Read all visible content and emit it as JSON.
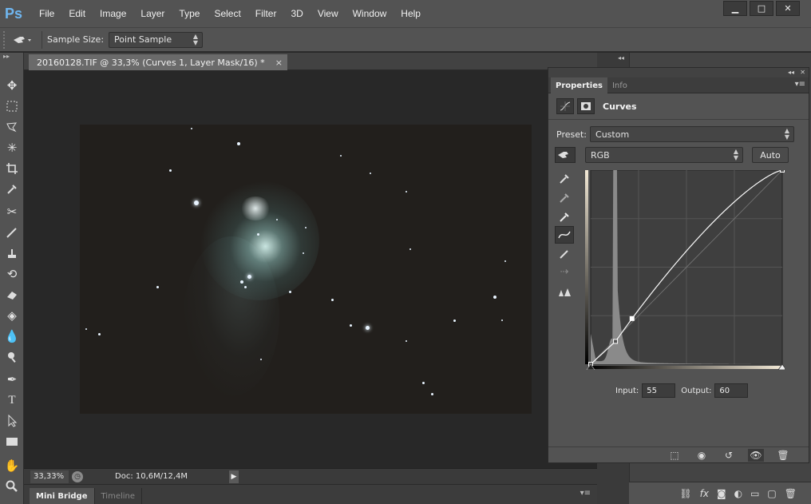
{
  "app": {
    "logo": "Ps"
  },
  "menu": [
    "File",
    "Edit",
    "Image",
    "Layer",
    "Type",
    "Select",
    "Filter",
    "3D",
    "View",
    "Window",
    "Help"
  ],
  "window_controls": {
    "minimize": "▁",
    "maximize": "□",
    "close": "✕"
  },
  "options_bar": {
    "tool_icon": "color-sampler-icon",
    "sample_size_label": "Sample Size:",
    "sample_size_value": "Point Sample"
  },
  "document": {
    "tab_title": "20160128.TIF @ 33,3% (Curves 1, Layer Mask/16) *",
    "close": "×"
  },
  "status": {
    "zoom": "33,33%",
    "doc_info": "Doc: 10,6M/12,4M"
  },
  "bottom_tabs": [
    "Mini Bridge",
    "Timeline"
  ],
  "properties": {
    "tabs": [
      "Properties",
      "Info"
    ],
    "title": "Curves",
    "preset_label": "Preset:",
    "preset_value": "Custom",
    "channel_value": "RGB",
    "auto_label": "Auto",
    "input_label": "Input:",
    "input_value": "55",
    "output_label": "Output:",
    "output_value": "60"
  },
  "curve": {
    "points": [
      [
        0,
        0
      ],
      [
        33,
        30
      ],
      [
        55,
        60
      ],
      [
        255,
        255
      ]
    ],
    "selected_point": [
      55,
      60
    ],
    "histogram_peak_at": 33,
    "accent": "#ffffff"
  }
}
